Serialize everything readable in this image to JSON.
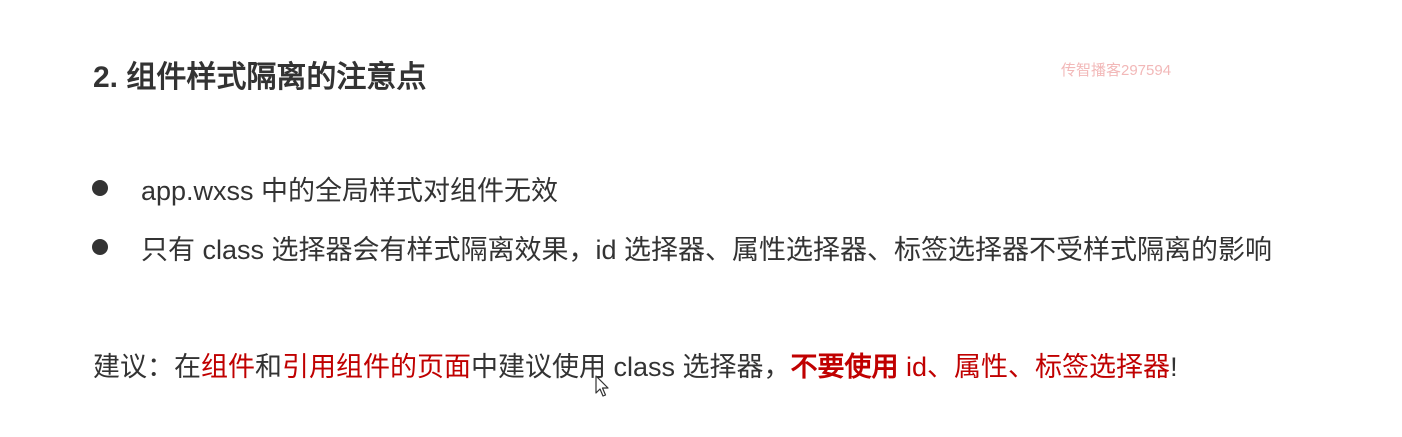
{
  "heading": "2. 组件样式隔离的注意点",
  "watermark": "传智播客297594",
  "bullets": [
    {
      "text": "app.wxss 中的全局样式对组件无效"
    },
    {
      "text": "只有 class 选择器会有样式隔离效果，id 选择器、属性选择器、标签选择器不受样式隔离的影响"
    }
  ],
  "advice": {
    "part1": "建议：在",
    "part2": "组件",
    "part3": "和",
    "part4": "引用组件的页面",
    "part5": "中建议使用 class 选择器，",
    "part6": "不要使用",
    "part7": " id、属性、标签选择器",
    "part8": "!"
  },
  "colors": {
    "text": "#333333",
    "emphasis": "#c00000",
    "watermark": "#f2b8b8"
  },
  "icons": {
    "cursor": "mouse-pointer-icon",
    "bullet": "bullet-dot-icon"
  }
}
